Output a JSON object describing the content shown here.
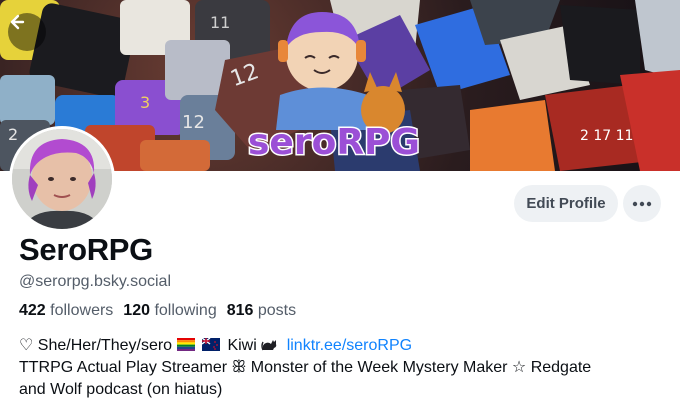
{
  "profile": {
    "display_name": "SeroRPG",
    "handle": "@serorpg.bsky.social",
    "banner_logo_text": "seroRPG",
    "stats": {
      "followers_count": "422",
      "followers_label": "followers",
      "following_count": "120",
      "following_label": "following",
      "posts_count": "816",
      "posts_label": "posts"
    },
    "bio": {
      "line1_prefix": "♡ She/Her/They/sero",
      "line1_kiwi": "Kiwi",
      "line1_link": "linktr.ee/seroRPG",
      "line2": "TTRPG Actual Play Streamer ꕥ Monster of the Week Mystery Maker ☆ Redgate",
      "line3": "and Wolf podcast (on hiatus)"
    }
  },
  "actions": {
    "edit_profile_label": "Edit Profile"
  },
  "icons": {
    "back": "arrow-left-icon",
    "more": "ellipsis-icon",
    "cat": "black-cat-icon"
  },
  "colors": {
    "link": "#1083fe",
    "button_bg": "#eef1f4",
    "secondary_text": "#545d69",
    "logo_purple": "#9b4fd6"
  }
}
